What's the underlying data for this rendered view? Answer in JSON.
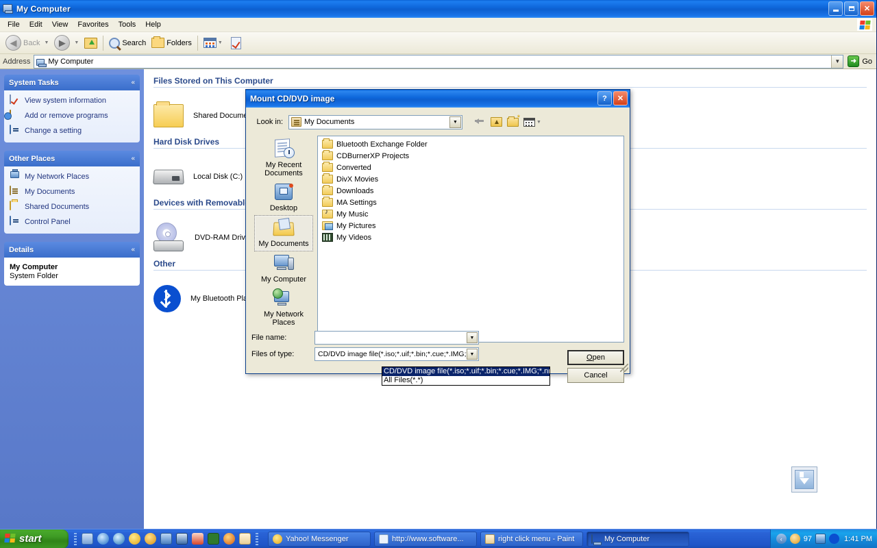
{
  "window": {
    "title": "My Computer",
    "icon": "my-computer-icon",
    "minimize_label": "Minimize",
    "maximize_label": "Maximize",
    "close_label": "Close",
    "menu": [
      "File",
      "Edit",
      "View",
      "Favorites",
      "Tools",
      "Help"
    ],
    "toolbar": {
      "back": "Back",
      "forward": "Forward",
      "up": "Up",
      "search": "Search",
      "folders": "Folders",
      "views": "Views"
    },
    "address": {
      "label": "Address",
      "value": "My Computer",
      "go_label": "Go"
    }
  },
  "sidebar": {
    "panels": [
      {
        "title": "System Tasks",
        "items": [
          {
            "label": "View system information",
            "icon": "system-info-icon"
          },
          {
            "label": "Add or remove programs",
            "icon": "add-remove-programs-icon"
          },
          {
            "label": "Change a setting",
            "icon": "change-setting-icon"
          }
        ]
      },
      {
        "title": "Other Places",
        "items": [
          {
            "label": "My Network Places",
            "icon": "network-places-icon"
          },
          {
            "label": "My Documents",
            "icon": "my-documents-icon"
          },
          {
            "label": "Shared Documents",
            "icon": "shared-documents-icon"
          },
          {
            "label": "Control Panel",
            "icon": "control-panel-icon"
          }
        ]
      },
      {
        "title": "Details",
        "detail_name": "My Computer",
        "detail_type": "System Folder"
      }
    ],
    "collapse_glyph": "«"
  },
  "content": {
    "groups": [
      {
        "header": "Files Stored on This Computer",
        "items": [
          {
            "label": "Shared Documents",
            "icon": "shared-folder-icon"
          }
        ]
      },
      {
        "header": "Hard Disk Drives",
        "items": [
          {
            "label": "Local Disk (C:)",
            "icon": "hard-disk-icon"
          }
        ]
      },
      {
        "header": "Devices with Removable Storage",
        "items": [
          {
            "label": "DVD-RAM Drive (D:)",
            "icon": "dvd-drive-icon"
          }
        ]
      },
      {
        "header": "Other",
        "items": [
          {
            "label": "My Bluetooth Places",
            "icon": "bluetooth-icon"
          }
        ]
      }
    ]
  },
  "dialog": {
    "title": "Mount CD/DVD image",
    "help_label": "?",
    "close_label": "✕",
    "look_in_label": "Look in:",
    "look_in_value": "My Documents",
    "toolbar": {
      "back": "Back",
      "up_one_level": "Up One Level",
      "new_folder": "Create New Folder",
      "views": "Views"
    },
    "places": [
      {
        "label": "My Recent Documents",
        "icon": "recent-documents-icon",
        "selected": false
      },
      {
        "label": "Desktop",
        "icon": "desktop-icon",
        "selected": false
      },
      {
        "label": "My Documents",
        "icon": "my-documents-icon",
        "selected": true
      },
      {
        "label": "My Computer",
        "icon": "my-computer-icon",
        "selected": false
      },
      {
        "label": "My Network Places",
        "icon": "my-network-places-icon",
        "selected": false
      }
    ],
    "files": [
      {
        "name": "Bluetooth Exchange Folder",
        "icon": "folder-icon"
      },
      {
        "name": "CDBurnerXP Projects",
        "icon": "folder-icon"
      },
      {
        "name": "Converted",
        "icon": "folder-icon"
      },
      {
        "name": "DivX Movies",
        "icon": "folder-icon"
      },
      {
        "name": "Downloads",
        "icon": "folder-icon"
      },
      {
        "name": "MA Settings",
        "icon": "folder-icon"
      },
      {
        "name": "My Music",
        "icon": "music-folder-icon"
      },
      {
        "name": "My Pictures",
        "icon": "pictures-folder-icon"
      },
      {
        "name": "My Videos",
        "icon": "videos-folder-icon"
      }
    ],
    "file_name_label": "File name:",
    "file_name_value": "",
    "files_of_type_label": "Files of type:",
    "files_of_type_value": "CD/DVD image file(*.iso;*.uif;*.bin;*.cue;*.IMG;*",
    "type_options": [
      {
        "label": "CD/DVD image file(*.iso;*.uif;*.bin;*.cue;*.IMG;*.nrg",
        "selected": true
      },
      {
        "label": "All Files(*.*)",
        "selected": false
      }
    ],
    "open_button": "Open",
    "cancel_button": "Cancel"
  },
  "desktop_widget": {
    "name": "download-arrow-widget"
  },
  "taskbar": {
    "start_label": "start",
    "quick_launch": [
      "show-desktop-icon",
      "internet-explorer-icon",
      "windows-media-player-icon",
      "yahoo-messenger-icon",
      "google-chrome-icon",
      "network-icon",
      "volume-icon",
      "nero-icon",
      "green-app-icon",
      "firefox-icon",
      "paint-icon"
    ],
    "tasks": [
      {
        "label": "Yahoo! Messenger",
        "icon": "yahoo-icon",
        "active": false
      },
      {
        "label": "http://www.software...",
        "icon": "ie-page-icon",
        "active": false
      },
      {
        "label": "right click menu - Paint",
        "icon": "paint-icon",
        "active": false
      },
      {
        "label": "My Computer",
        "icon": "my-computer-icon",
        "active": true
      }
    ],
    "tray": {
      "show_hidden": "‹",
      "icons": [
        "security-icon",
        "counter-97",
        "updates-icon",
        "bluetooth-icon"
      ],
      "counter": "97",
      "time": "1:41 PM"
    }
  },
  "colors": {
    "desktop": "#5b7fd4",
    "titlebar_blue": "#0f68dc",
    "sidebar_blue": "#6a8ad4",
    "selection": "#0a246a",
    "start_green": "#3f9c25"
  }
}
